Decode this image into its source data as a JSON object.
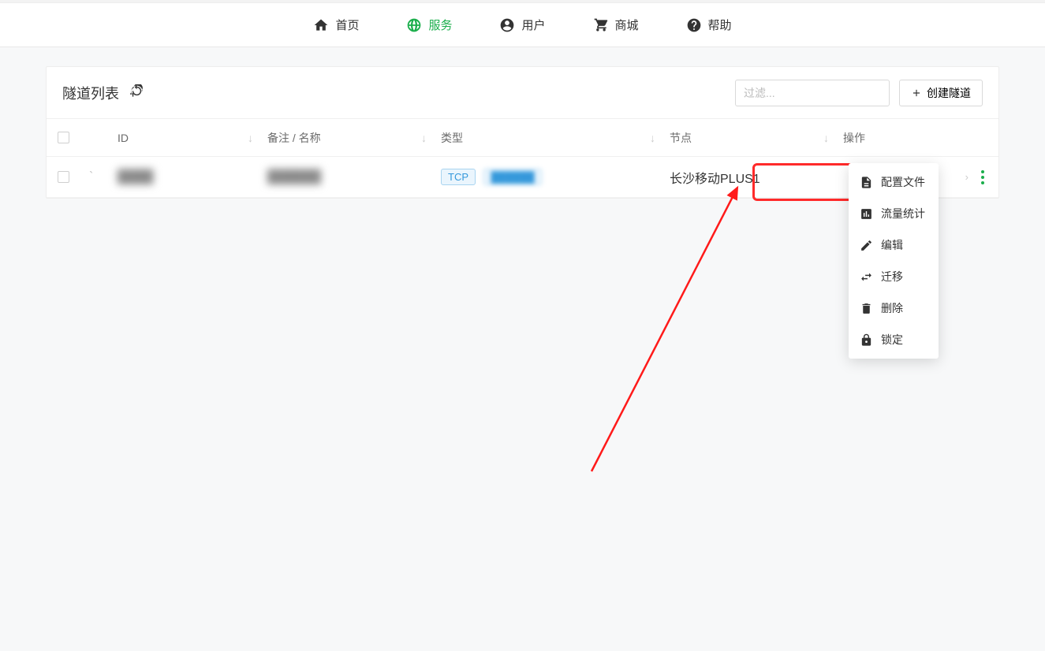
{
  "nav": {
    "home": "首页",
    "service": "服务",
    "user": "用户",
    "shop": "商城",
    "help": "帮助"
  },
  "header": {
    "title": "隧道列表",
    "filter_placeholder": "过滤...",
    "create_label": "创建隧道"
  },
  "columns": {
    "id": "ID",
    "name": "备注 / 名称",
    "type": "类型",
    "node": "节点",
    "action": "操作"
  },
  "row": {
    "id_blurred": "████",
    "name_blurred": "██████",
    "type_tag": "TCP",
    "port_blurred": "██████",
    "node": "长沙移动PLUS1"
  },
  "menu": {
    "config": "配置文件",
    "traffic": "流量统计",
    "edit": "编辑",
    "migrate": "迁移",
    "delete": "删除",
    "lock": "锁定"
  }
}
